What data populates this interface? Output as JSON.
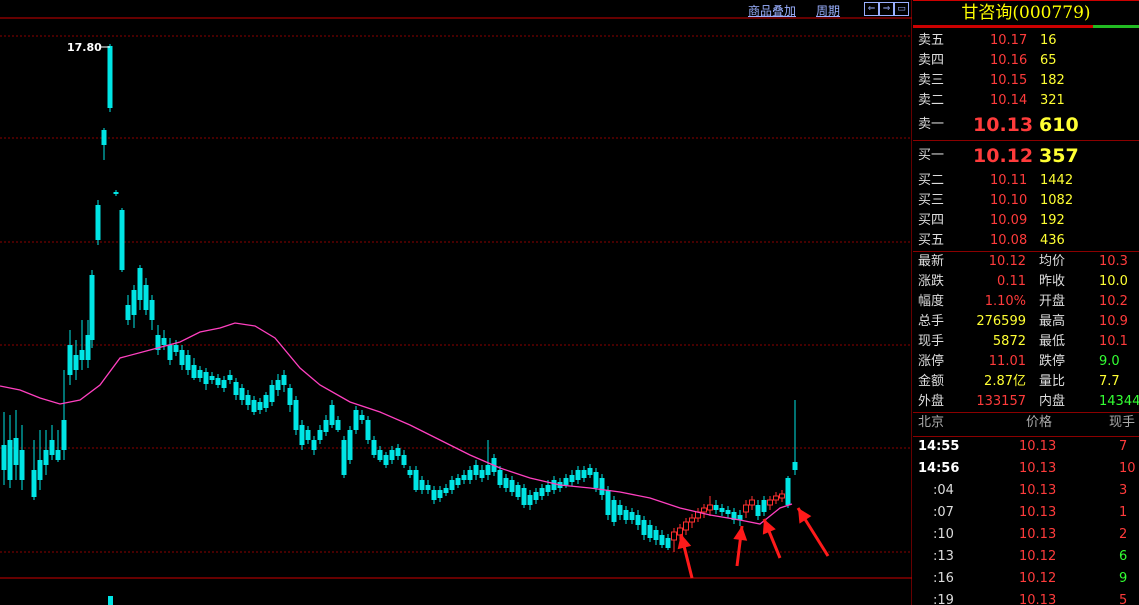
{
  "toolbar": {
    "overlay_label": "商品叠加",
    "period_label": "周期",
    "nav_buttons": [
      "⇐",
      "⇒",
      "▭"
    ]
  },
  "chart": {
    "high_label": "17.80",
    "colors": {
      "up": "#ff3030",
      "down": "#00e5e5",
      "ma": "#ff40c0",
      "grid": "#8b0000",
      "arrow": "#ff1a1a"
    }
  },
  "panel": {
    "stock_title": "甘咨询(000779)",
    "sells": [
      {
        "label": "卖五",
        "price": "10.17",
        "vol": "16"
      },
      {
        "label": "卖四",
        "price": "10.16",
        "vol": "65"
      },
      {
        "label": "卖三",
        "price": "10.15",
        "vol": "182"
      },
      {
        "label": "卖二",
        "price": "10.14",
        "vol": "321"
      },
      {
        "label": "卖一",
        "price": "10.13",
        "vol": "610"
      }
    ],
    "buys": [
      {
        "label": "买一",
        "price": "10.12",
        "vol": "357"
      },
      {
        "label": "买二",
        "price": "10.11",
        "vol": "1442"
      },
      {
        "label": "买三",
        "price": "10.10",
        "vol": "1082"
      },
      {
        "label": "买四",
        "price": "10.09",
        "vol": "192"
      },
      {
        "label": "买五",
        "price": "10.08",
        "vol": "436"
      }
    ],
    "quote": [
      {
        "l1": "最新",
        "v1": "10.12",
        "c1": "red",
        "l2": "均价",
        "v2": "10.3",
        "c2": "red"
      },
      {
        "l1": "涨跌",
        "v1": "0.11",
        "c1": "red",
        "l2": "昨收",
        "v2": "10.0",
        "c2": "yel"
      },
      {
        "l1": "幅度",
        "v1": "1.10%",
        "c1": "red",
        "l2": "开盘",
        "v2": "10.2",
        "c2": "red"
      },
      {
        "l1": "总手",
        "v1": "276599",
        "c1": "yel",
        "l2": "最高",
        "v2": "10.9",
        "c2": "red"
      },
      {
        "l1": "现手",
        "v1": "5872",
        "c1": "yel",
        "l2": "最低",
        "v2": "10.1",
        "c2": "red"
      },
      {
        "l1": "涨停",
        "v1": "11.01",
        "c1": "red",
        "l2": "跌停",
        "v2": "9.0",
        "c2": "grn"
      },
      {
        "l1": "金额",
        "v1": "2.87亿",
        "c1": "yel",
        "l2": "量比",
        "v2": "7.7",
        "c2": "yel"
      },
      {
        "l1": "外盘",
        "v1": "133157",
        "c1": "red",
        "l2": "内盘",
        "v2": "14344",
        "c2": "grn"
      }
    ],
    "ticks_header": {
      "col1": "北京",
      "col2": "价格",
      "col3": "现手"
    },
    "ticks": [
      {
        "time": "14:55",
        "price": "10.13",
        "vol": "7",
        "bold": true,
        "vc": "red"
      },
      {
        "time": "14:56",
        "price": "10.13",
        "vol": "10",
        "bold": true,
        "vc": "red"
      },
      {
        "time": ":04",
        "price": "10.13",
        "vol": "3",
        "bold": false,
        "vc": "red"
      },
      {
        "time": ":07",
        "price": "10.13",
        "vol": "1",
        "bold": false,
        "vc": "red"
      },
      {
        "time": ":10",
        "price": "10.13",
        "vol": "2",
        "bold": false,
        "vc": "red"
      },
      {
        "time": ":13",
        "price": "10.12",
        "vol": "6",
        "bold": false,
        "vc": "grn"
      },
      {
        "time": ":16",
        "price": "10.12",
        "vol": "9",
        "bold": false,
        "vc": "grn"
      },
      {
        "time": ":19",
        "price": "10.13",
        "vol": "5",
        "bold": false,
        "vc": "red"
      }
    ]
  }
}
